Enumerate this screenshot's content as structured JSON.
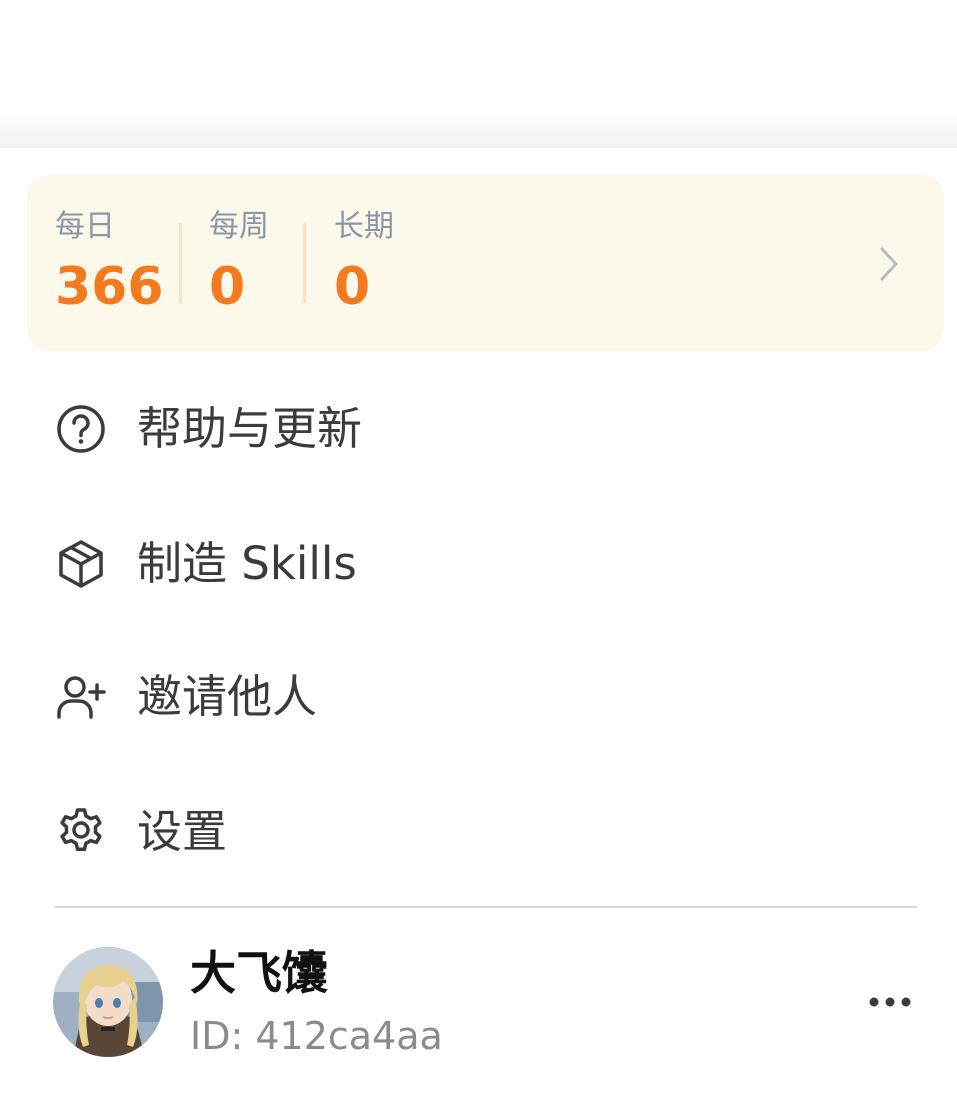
{
  "stats": {
    "daily": {
      "label": "每日",
      "value": "366"
    },
    "weekly": {
      "label": "每周",
      "value": "0"
    },
    "long_term": {
      "label": "长期",
      "value": "0"
    },
    "chevron_icon": "chevron-right-icon"
  },
  "menu": [
    {
      "label": "帮助与更新",
      "icon": "help-circle-icon"
    },
    {
      "label": "制造 Skills",
      "icon": "box-icon"
    },
    {
      "label": "邀请他人",
      "icon": "user-plus-icon"
    },
    {
      "label": "设置",
      "icon": "gear-icon"
    }
  ],
  "user": {
    "name": "大飞馕",
    "id_text": "ID: 412ca4aa",
    "more_icon": "more-horizontal-icon"
  },
  "colors": {
    "accent": "#f47a20",
    "card_bg": "#fdf9ea",
    "label_gray": "#8a96a8",
    "text_dark": "#3a3a3f"
  }
}
